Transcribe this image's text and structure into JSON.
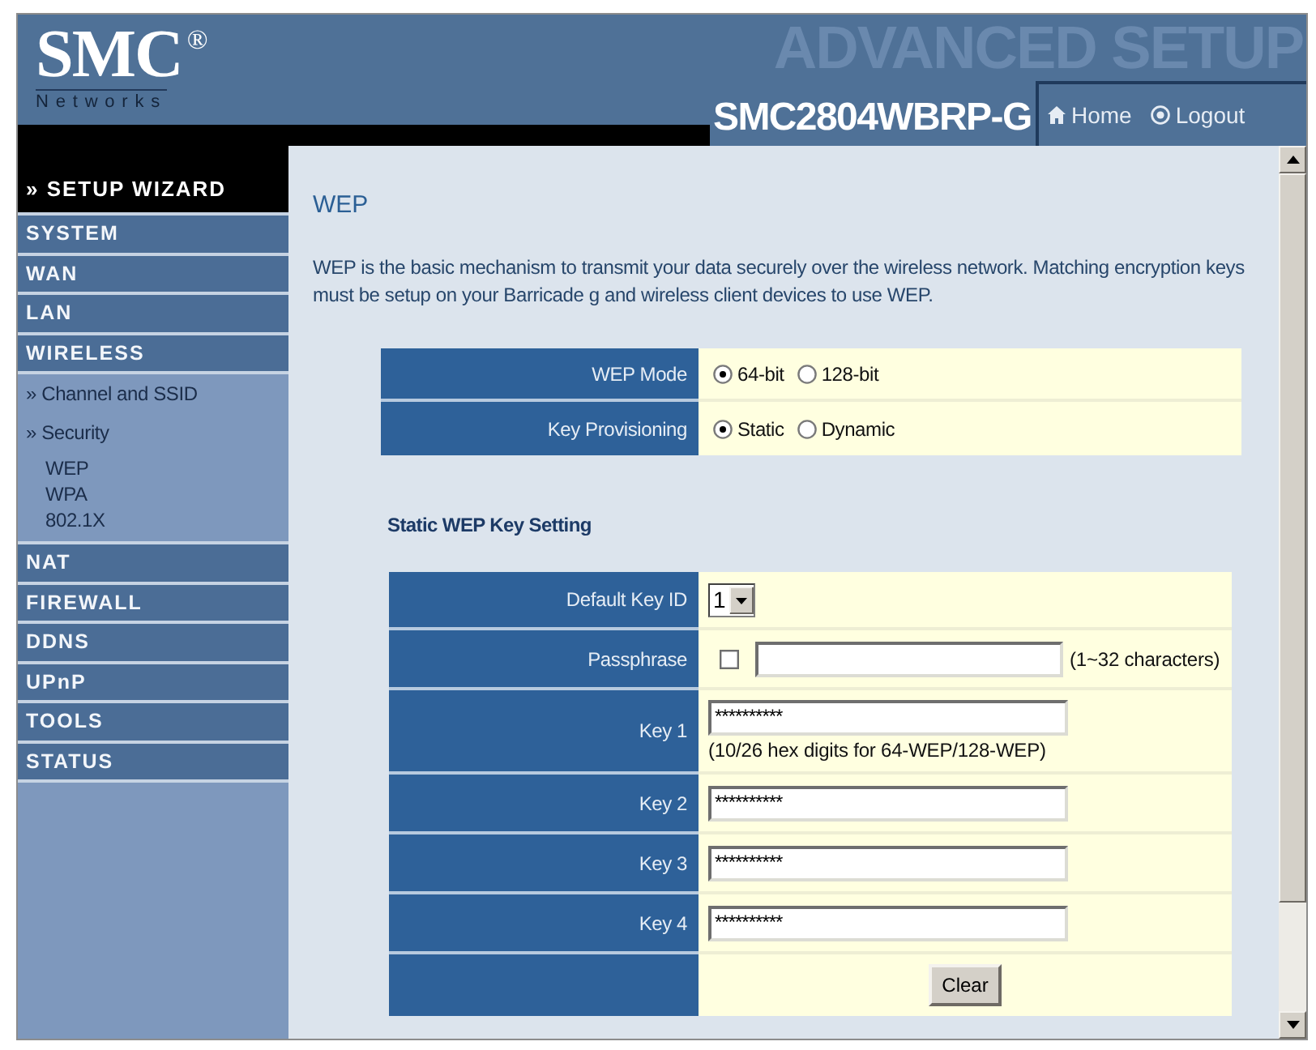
{
  "header": {
    "logo": "SMC$^{®}$",
    "logo_subtitle": "Networks",
    "banner": "ADVANCED SETUP",
    "model": "SMC2804WBRP-G",
    "links": [
      {
        "kind": "home",
        "label": "Home"
      },
      {
        "kind": "logout",
        "label": "Logout"
      }
    ]
  },
  "sidebar": {
    "items": [
      {
        "kind": "wizard",
        "label": "» SETUP WIZARD"
      },
      {
        "kind": "section",
        "label": "SYSTEM"
      },
      {
        "kind": "section",
        "label": "WAN"
      },
      {
        "kind": "section",
        "label": "LAN"
      },
      {
        "kind": "section",
        "label": "WIRELESS",
        "children": [
          {
            "label": "» Channel and SSID"
          },
          {
            "label": "» Security",
            "children": [
              {
                "label": "WEP"
              },
              {
                "label": "WPA"
              },
              {
                "label": "802.1X"
              }
            ]
          }
        ]
      },
      {
        "kind": "section",
        "label": "NAT"
      },
      {
        "kind": "section",
        "label": "FIREWALL"
      },
      {
        "kind": "section",
        "label": "DDNS"
      },
      {
        "kind": "section",
        "label": "UPnP"
      },
      {
        "kind": "section",
        "label": "TOOLS"
      },
      {
        "kind": "section",
        "label": "STATUS"
      }
    ]
  },
  "page": {
    "title": "WEP",
    "description": "WEP is the basic mechanism to transmit your data securely over the wireless network. Matching encryption keys must be setup on your Barricade g and wireless client devices to use WEP."
  },
  "mode_settings": [
    {
      "label": "WEP Mode",
      "options": [
        {
          "label": "64-bit",
          "selected": true
        },
        {
          "label": "128-bit",
          "selected": false
        }
      ]
    },
    {
      "label": "Key Provisioning",
      "options": [
        {
          "label": "Static",
          "selected": true
        },
        {
          "label": "Dynamic",
          "selected": false
        }
      ]
    }
  ],
  "static_wep": {
    "title": "Static WEP Key Setting",
    "rows": [
      {
        "kind": "select",
        "label": "Default Key ID",
        "value": "1"
      },
      {
        "kind": "passphrase",
        "label": "Passphrase",
        "checked": false,
        "note": "(1~32 characters)"
      },
      {
        "kind": "key",
        "label": "Key 1",
        "value": "**********",
        "note": "(10/26 hex digits for 64-WEP/128-WEP)"
      },
      {
        "kind": "key",
        "label": "Key 2",
        "value": "**********"
      },
      {
        "kind": "key",
        "label": "Key 3",
        "value": "**********"
      },
      {
        "kind": "key",
        "label": "Key 4",
        "value": "**********"
      },
      {
        "kind": "action",
        "button": "Clear"
      }
    ]
  }
}
